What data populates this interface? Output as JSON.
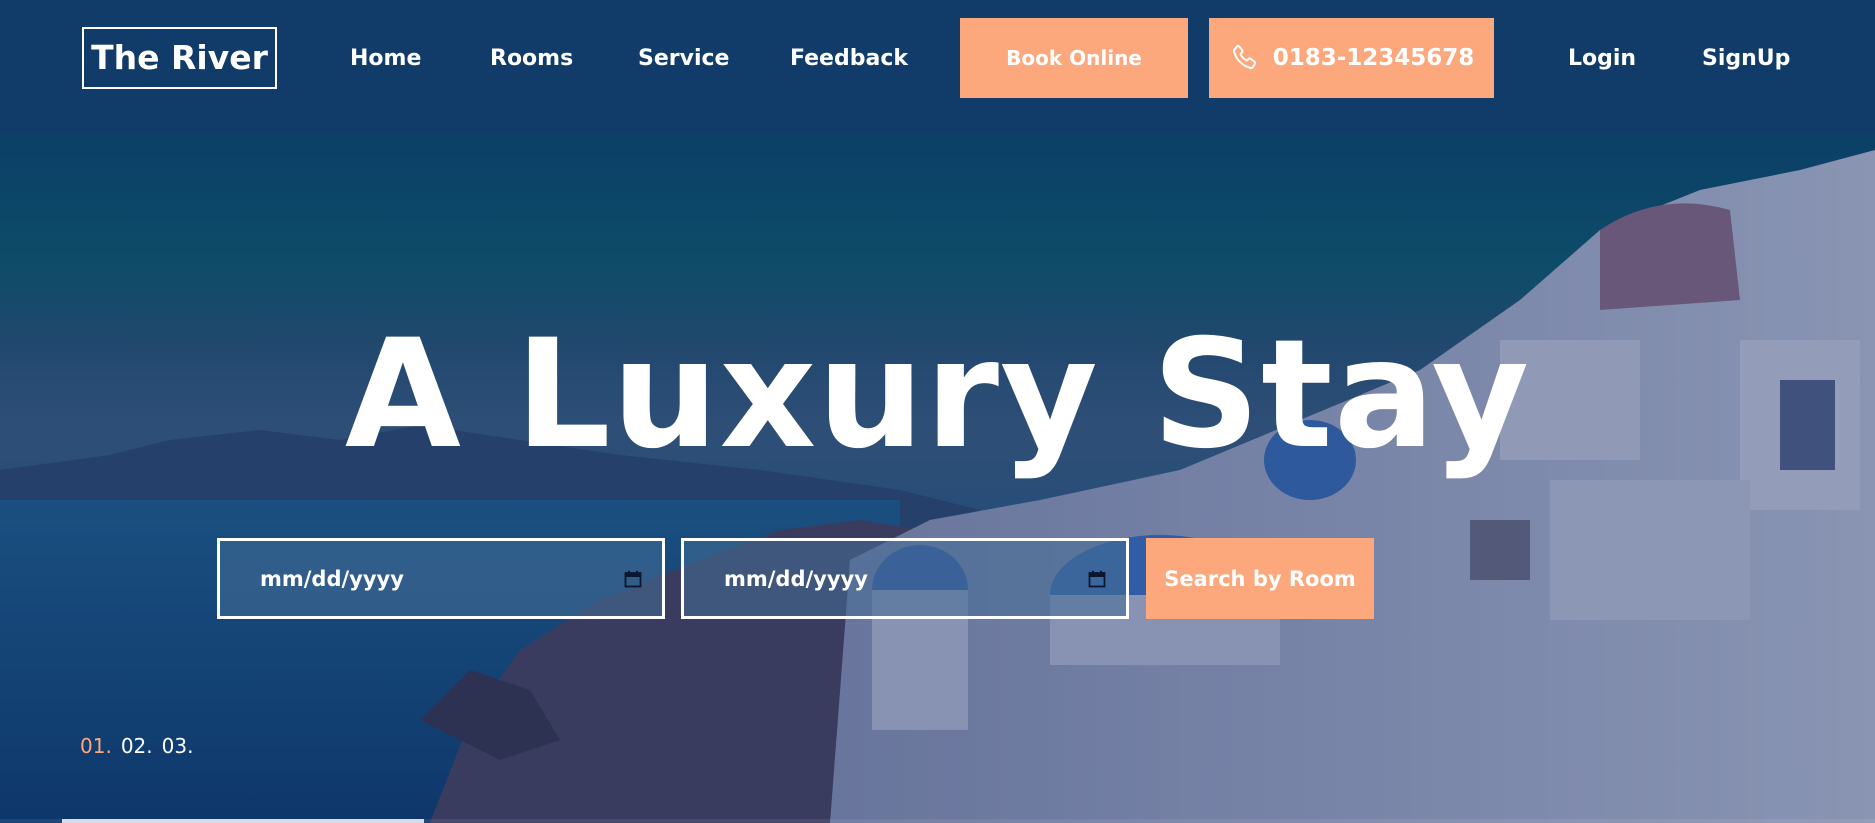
{
  "brand": {
    "name": "The River"
  },
  "nav": {
    "items": [
      {
        "label": "Home"
      },
      {
        "label": "Rooms"
      },
      {
        "label": "Service"
      },
      {
        "label": "Feedback"
      }
    ],
    "book_label": "Book Online",
    "phone": {
      "icon": "phone-icon",
      "number": "0183-12345678"
    },
    "login_label": "Login",
    "signup_label": "SignUp"
  },
  "hero": {
    "headline": "A Luxury Stay",
    "checkin": {
      "placeholder": "mm/dd/yyyy",
      "icon": "calendar-icon"
    },
    "checkout": {
      "placeholder": "mm/dd/yyyy",
      "icon": "calendar-icon"
    },
    "search_label": "Search by Room",
    "slides": [
      "01.",
      "02.",
      "03."
    ],
    "active_slide": 0,
    "slide_progress": 0.193
  },
  "colors": {
    "header_bg": "#113c69",
    "accent": "#fca77c",
    "text": "#ffffff"
  }
}
